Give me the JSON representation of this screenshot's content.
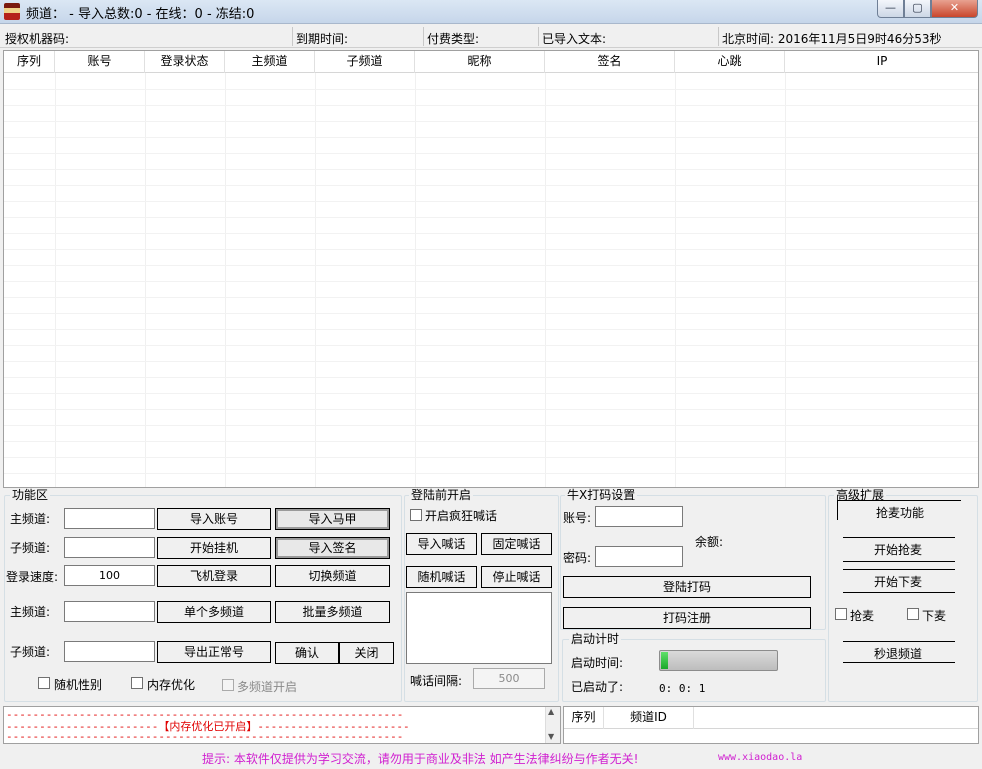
{
  "window": {
    "title": "频道： - 导入总数:0 - 在线：0 - 冻结:0",
    "min_glyph": "—",
    "max_glyph": "▢",
    "close_glyph": "✕"
  },
  "info": {
    "auth_machine": "授权机器码:",
    "expire": "到期时间:",
    "pay_type": "付费类型:",
    "imported_text": "已导入文本:",
    "beijing_time": "北京时间: 2016年11月5日9时46分53秒"
  },
  "table": {
    "columns": [
      "序列",
      "账号",
      "登录状态",
      "主频道",
      "子频道",
      "昵称",
      "签名",
      "心跳",
      "IP"
    ]
  },
  "func": {
    "legend": "功能区",
    "main_channel_label": "主频道:",
    "sub_channel_label": "子频道:",
    "login_speed_label": "登录速度:",
    "login_speed_value": "100",
    "main_channel_label2": "主频道:",
    "sub_channel_label2": "子频道:",
    "import_account": "导入账号",
    "import_vest": "导入马甲",
    "start_hang": "开始挂机",
    "import_sign": "导入签名",
    "plane_login": "飞机登录",
    "switch_channel": "切换频道",
    "single_multi": "单个多频道",
    "batch_multi": "批量多频道",
    "export_normal": "导出正常号",
    "confirm": "确认",
    "close": "关闭",
    "random_gender": "随机性别",
    "mem_opt": "内存优化",
    "multi_open": "多频道开启"
  },
  "prelogin": {
    "legend": "登陆前开启",
    "crazy_shout": "开启疯狂喊话",
    "import_shout": "导入喊话",
    "fixed_shout": "固定喊话",
    "random_shout": "随机喊话",
    "stop_shout": "停止喊话",
    "interval_label": "喊话间隔:",
    "interval_value": "500"
  },
  "captcha": {
    "legend": "牛X打码设置",
    "account_label": "账号:",
    "password_label": "密码:",
    "balance_label": "余额:",
    "login_captcha": "登陆打码",
    "captcha_register": "打码注册"
  },
  "timer": {
    "legend": "启动计时",
    "start_time_label": "启动时间:",
    "started_label": "已启动了:",
    "elapsed": "0: 0: 1",
    "progress_fraction": 0.06
  },
  "advanced": {
    "legend": "高级扩展",
    "grab_mic_feature": "抢麦功能",
    "start_grab": "开始抢麦",
    "start_down": "开始下麦",
    "grab_mic": "抢麦",
    "down_mic": "下麦",
    "quit_channel": "秒退频道"
  },
  "log": {
    "line1": "------------------------------------------------------------",
    "line2": "-----------------------【内存优化已开启】-----------------------",
    "line3": "------------------------------------------------------------",
    "scroll_up": "▲",
    "scroll_down": "▼"
  },
  "channel_list": {
    "columns": [
      "序列",
      "频道ID"
    ]
  },
  "footer": {
    "notice": "提示: 本软件仅提供为学习交流，请勿用于商业及非法 如产生法律纠纷与作者无关!",
    "site": "www.xiaodao.la",
    "notice_color": "#d020d0"
  }
}
